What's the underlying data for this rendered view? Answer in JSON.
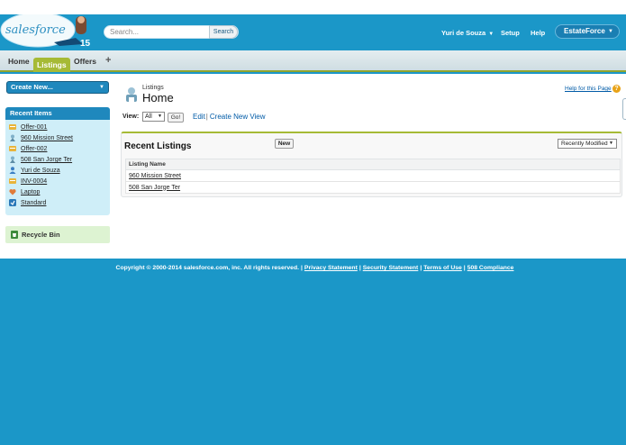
{
  "colors": {
    "brand_blue": "#1b97c8",
    "accent_green": "#a6ba35",
    "link_blue": "#015ba7"
  },
  "header": {
    "logo_text": "salesforce",
    "logo_badge": "15",
    "search": {
      "placeholder": "Search...",
      "button_label": "Search"
    },
    "user_name": "Yuri de Souza",
    "setup_label": "Setup",
    "help_label": "Help",
    "app_name": "EstateForce"
  },
  "tabs": [
    {
      "label": "Home",
      "active": false
    },
    {
      "label": "Listings",
      "active": true
    },
    {
      "label": "Offers",
      "active": false
    }
  ],
  "tab_plus": "+",
  "sidebar": {
    "create_new_label": "Create New...",
    "recent_items_title": "Recent Items",
    "recent_items": [
      {
        "label": "Offer-001",
        "icon": "offer-icon"
      },
      {
        "label": "960 Mission Street",
        "icon": "listing-icon"
      },
      {
        "label": "Offer-002",
        "icon": "offer-icon"
      },
      {
        "label": "508 San Jorge Ter",
        "icon": "listing-icon"
      },
      {
        "label": "Yuri de Souza",
        "icon": "user-icon"
      },
      {
        "label": "INV-0004",
        "icon": "invoice-icon"
      },
      {
        "label": "Laptop",
        "icon": "product-icon"
      },
      {
        "label": "Standard",
        "icon": "pricebook-icon"
      }
    ],
    "recycle_bin_label": "Recycle Bin"
  },
  "page": {
    "object_label": "Listings",
    "title": "Home",
    "help_link": "Help for this Page",
    "help_icon_glyph": "?",
    "view_label": "View:",
    "view_selected": "All",
    "go_label": "Go!",
    "edit_link": "Edit",
    "create_view_link": "Create New View",
    "list": {
      "title": "Recent Listings",
      "new_button": "New",
      "sort_selected": "Recently Modified",
      "column_header": "Listing Name",
      "rows": [
        "960 Mission Street",
        "508 San Jorge Ter"
      ]
    }
  },
  "footer": {
    "copyright": "Copyright © 2000-2014 salesforce.com, inc. All rights reserved.",
    "links": [
      "Privacy Statement",
      "Security Statement",
      "Terms of Use",
      "508 Compliance"
    ]
  }
}
